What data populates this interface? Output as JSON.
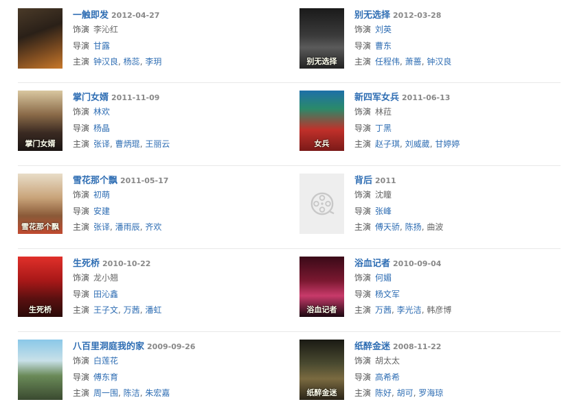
{
  "labels": {
    "role": "饰演",
    "director": "导演",
    "cast": "主演"
  },
  "items": [
    {
      "title": "一触即发",
      "date": "2012-04-27",
      "role": "李沁红",
      "director": "甘露",
      "cast1": "钟汉良",
      "cast2": "杨蕊",
      "cast3": "李玥",
      "poster_text": ""
    },
    {
      "title": "别无选择",
      "date": "2012-03-28",
      "role": "刘英",
      "director": "曹东",
      "cast1": "任程伟",
      "cast2": "萧蔷",
      "cast3": "钟汉良",
      "poster_text": "别无选择"
    },
    {
      "title": "掌门女婿",
      "date": "2011-11-09",
      "role": "林欢",
      "director": "杨晶",
      "cast1": "张译",
      "cast2": "曹炳琨",
      "cast3": "王丽云",
      "poster_text": "掌门女婿"
    },
    {
      "title": "新四军女兵",
      "date": "2011-06-13",
      "role": "林菈",
      "director": "丁黑",
      "cast1": "赵子琪",
      "cast2": "刘威葳",
      "cast3": "甘婷婷",
      "poster_text": "女兵"
    },
    {
      "title": "雪花那个飘",
      "date": "2011-05-17",
      "role": "初萌",
      "director": "安建",
      "cast1": "张译",
      "cast2": "潘雨辰",
      "cast3": "齐欢",
      "poster_text": "雪花那个飘"
    },
    {
      "title": "背后",
      "date": "2011",
      "role": "沈瞳",
      "director": "张峰",
      "cast1": "傅天骄",
      "cast2": "陈扬",
      "cast3": "曲波",
      "poster_text": ""
    },
    {
      "title": "生死桥",
      "date": "2010-10-22",
      "role": "龙小翘",
      "director": "田沁鑫",
      "cast1": "王子文",
      "cast2": "万茜",
      "cast3": "潘虹",
      "poster_text": "生死桥"
    },
    {
      "title": "浴血记者",
      "date": "2010-09-04",
      "role": "何媚",
      "director": "杨文军",
      "cast1": "万茜",
      "cast2": "李光洁",
      "cast3": "韩彦博",
      "poster_text": "浴血记者"
    },
    {
      "title": "八百里洞庭我的家",
      "date": "2009-09-26",
      "role": "白莲花",
      "director": "傅东育",
      "cast1": "周一围",
      "cast2": "陈洁",
      "cast3": "朱宏嘉",
      "poster_text": ""
    },
    {
      "title": "纸醉金迷",
      "date": "2008-11-22",
      "role": "胡太太",
      "director": "高希希",
      "cast1": "陈好",
      "cast2": "胡可",
      "cast3": "罗海琼",
      "poster_text": "纸醉金迷"
    }
  ],
  "icons": {
    "placeholder": "film-reel-icon"
  },
  "colors": {
    "link": "#2e6db3",
    "date": "#888888",
    "divider": "#e8e8e8"
  }
}
